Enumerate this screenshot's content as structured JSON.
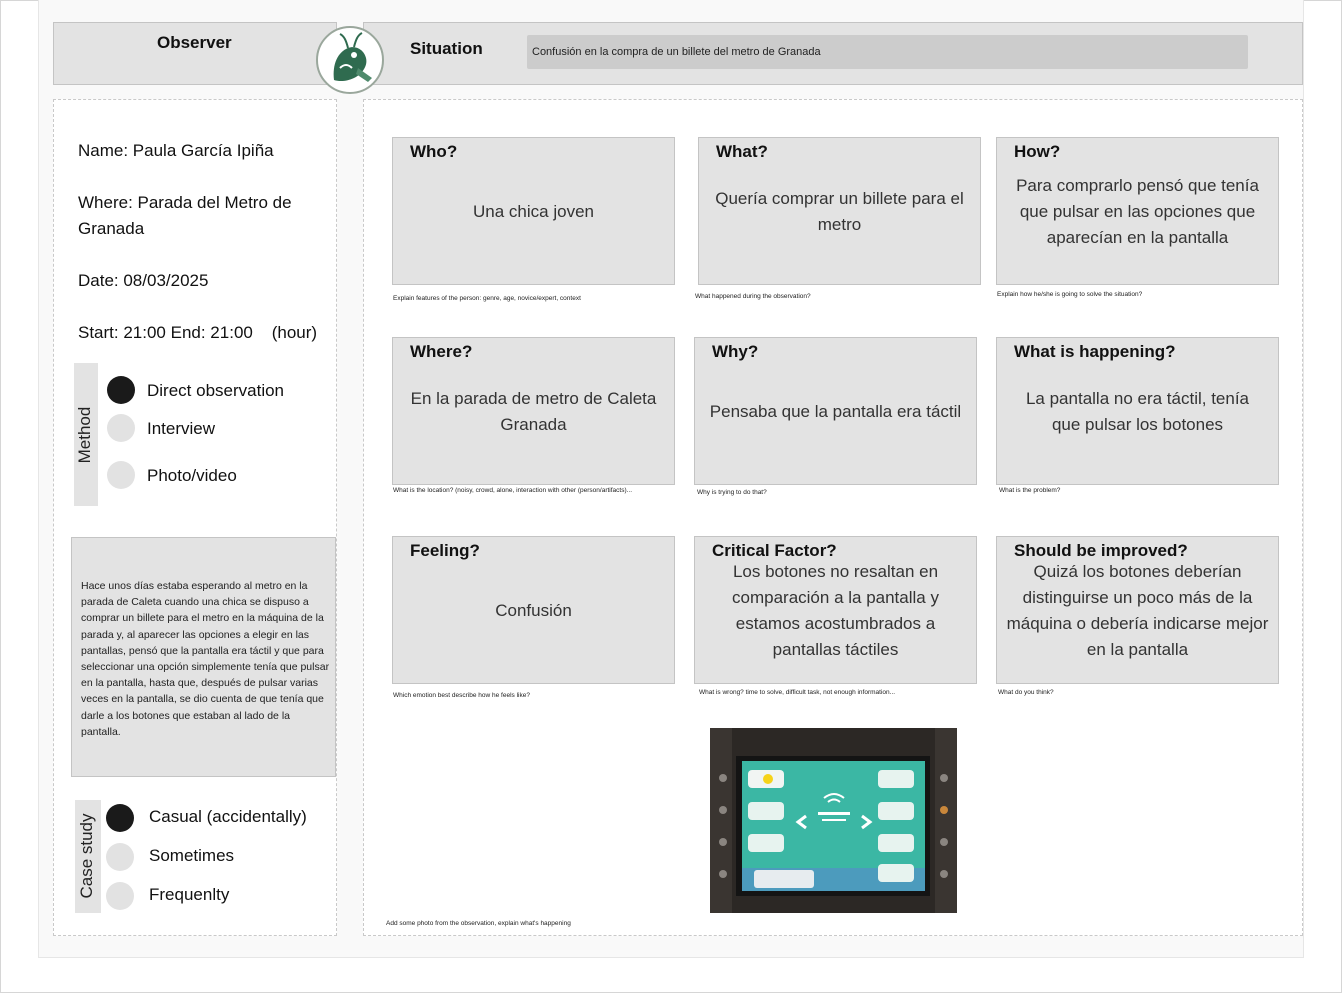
{
  "header": {
    "observer_label": "Observer",
    "situation_label": "Situation",
    "situation_value": "Confusión en la compra de un billete del metro de Granada"
  },
  "observer": {
    "name": "Name: Paula García Ipiña",
    "where_line1": "Where:  Parada del Metro de",
    "where_line2": "Granada",
    "date": "Date: 08/03/2025",
    "time": "Start: 21:00 End: 21:00    (hour)"
  },
  "method": {
    "label": "Method",
    "options": [
      {
        "label": "Direct observation",
        "selected": true
      },
      {
        "label": "Interview",
        "selected": false
      },
      {
        "label": "Photo/video",
        "selected": false
      }
    ]
  },
  "notes": "Hace unos días estaba esperando al metro en la parada de Caleta cuando una chica se dispuso a comprar un billete para el metro en la máquina de la parada y, al aparecer las opciones a elegir en las pantallas, pensó que la pantalla era táctil y que para seleccionar una opción simplemente tenía que pulsar en la pantalla, hasta que, después de pulsar varias veces en la pantalla, se dio cuenta de que tenía que darle a los botones que estaban al lado de la pantalla.",
  "case_study": {
    "label": "Case study",
    "options": [
      {
        "label": "Casual (accidentally)",
        "selected": true
      },
      {
        "label": "Sometimes",
        "selected": false
      },
      {
        "label": "Frequenlty",
        "selected": false
      }
    ]
  },
  "cards": {
    "who": {
      "title": "Who?",
      "body": "Una chica joven",
      "hint": "Explain features of the person: genre, age, novice/expert, context"
    },
    "what": {
      "title": "What?",
      "body": "Quería comprar un billete para el metro",
      "hint": "What happened during the observation?"
    },
    "how": {
      "title": "How?",
      "body": "Para comprarlo pensó que tenía que pulsar en las opciones que aparecían en la pantalla",
      "hint": "Explain how he/she is going to solve the situation?"
    },
    "where": {
      "title": "Where?",
      "body": "En la parada de metro de Caleta Granada",
      "hint": "What is the location? (noisy, crowd, alone, interaction with other (person/artifacts)..."
    },
    "why": {
      "title": "Why?",
      "body": "Pensaba que la pantalla era táctil",
      "hint": "Why is trying to do that?"
    },
    "happening": {
      "title": "What is happening?",
      "body": "La pantalla no era táctil, tenía que pulsar los botones",
      "hint": "What is the problem?"
    },
    "feeling": {
      "title": "Feeling?",
      "body": "Confusión",
      "hint": "Which emotion best describe how he feels like?"
    },
    "critical": {
      "title": "Critical Factor?",
      "body": "Los botones no resaltan en comparación a la pantalla y estamos acostumbrados a pantallas táctiles",
      "hint": "What is wrong? time to solve, difficult task, not enough information..."
    },
    "improve": {
      "title": "Should be improved?",
      "body": "Quizá los botones deberían distinguirse un poco más de la máquina o debería indicarse mejor en la pantalla",
      "hint": "What do you think?"
    }
  },
  "photo_hint": "Add some photo from the observation, explain what's happening",
  "colors": {
    "panel": "#e3e3e3",
    "dot_selected": "#1a1a1a",
    "dot_empty": "#e2e2e2",
    "logo_green": "#2f6b4f",
    "screen_teal": "#3bb7a4"
  }
}
